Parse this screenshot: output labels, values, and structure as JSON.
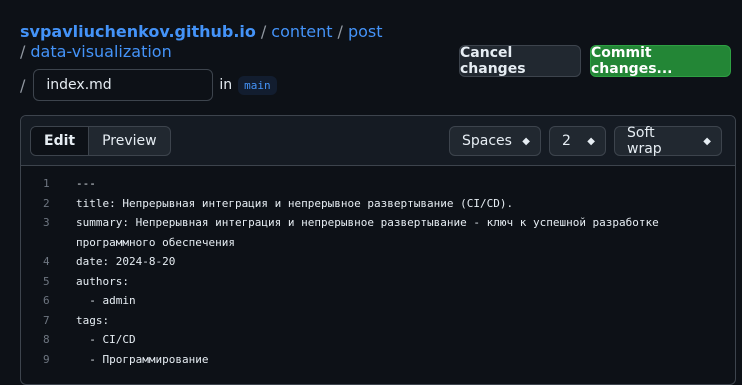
{
  "breadcrumb": {
    "repo": "svpavliuchenkov.github.io",
    "sep": "/",
    "parts": [
      "content",
      "post",
      "data-visualization"
    ]
  },
  "file": {
    "name": "index.md",
    "in_label": "in",
    "branch": "main"
  },
  "actions": {
    "cancel": "Cancel changes",
    "commit": "Commit changes..."
  },
  "editor": {
    "tabs": {
      "edit": "Edit",
      "preview": "Preview"
    },
    "indent_mode": "Spaces",
    "indent_size": "2",
    "wrap_mode": "Soft wrap",
    "lines": [
      {
        "n": "1",
        "text": "---"
      },
      {
        "n": "2",
        "text": "title: Непрерывная интеграция и непрерывное развертывание (CI/CD)."
      },
      {
        "n": "3",
        "text": "summary: Непрерывная интеграция и непрерывное развертывание - ключ к успешной разработке"
      },
      {
        "n": "",
        "text": "программного обеспечения"
      },
      {
        "n": "4",
        "text": "date: 2024-8-20"
      },
      {
        "n": "5",
        "text": "authors:"
      },
      {
        "n": "6",
        "text": "  - admin"
      },
      {
        "n": "7",
        "text": "tags:"
      },
      {
        "n": "8",
        "text": "  - CI/CD"
      },
      {
        "n": "9",
        "text": "  - Программирование"
      }
    ]
  }
}
